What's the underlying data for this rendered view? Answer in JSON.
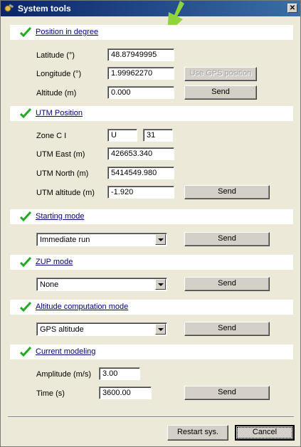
{
  "window": {
    "title": "System tools",
    "close_label": "✕"
  },
  "sections": {
    "position": "Position in degree",
    "utm": "UTM Position",
    "starting": "Starting mode",
    "zup": "ZUP mode",
    "altcomp": "Altitude computation mode",
    "modeling": "Current modeling"
  },
  "position": {
    "latitude_label": "Latitude (°)",
    "latitude_value": "48.87949995",
    "longitude_label": "Longitude (°)",
    "longitude_value": "1.99962270",
    "use_gps_label": "Use GPS position",
    "altitude_label": "Altitude (m)",
    "altitude_value": "0.000",
    "send_label": "Send"
  },
  "utm": {
    "zone_label": "Zone C I",
    "zone_letter": "U",
    "zone_number": "31",
    "east_label": "UTM East (m)",
    "east_value": "426653.340",
    "north_label": "UTM North (m)",
    "north_value": "5414549.980",
    "alt_label": "UTM altitude (m)",
    "alt_value": "-1.920",
    "send_label": "Send"
  },
  "starting": {
    "selected": "Immediate run",
    "send_label": "Send"
  },
  "zup": {
    "selected": "None",
    "send_label": "Send"
  },
  "altcomp": {
    "selected": "GPS altitude",
    "send_label": "Send"
  },
  "modeling": {
    "amplitude_label": "Amplitude (m/s)",
    "amplitude_value": "3.00",
    "time_label": "Time (s)",
    "time_value": "3600.00",
    "send_label": "Send"
  },
  "footer": {
    "restart_label": "Restart sys.",
    "cancel_label": "Cancel"
  },
  "colors": {
    "title_bar": "#0a246a",
    "check": "#22aa22",
    "arrow": "#8fd43a"
  }
}
